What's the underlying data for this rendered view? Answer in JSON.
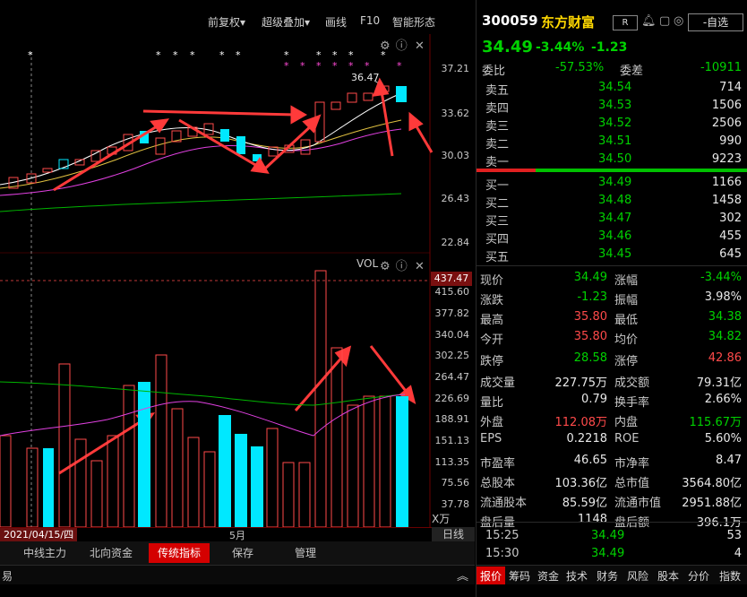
{
  "toolbar": {
    "items": [
      "前复权▾",
      "超级叠加▾",
      "画线",
      "F10",
      "智能形态"
    ]
  },
  "kline": {
    "yticks": [
      "37.21",
      "33.62",
      "30.03",
      "26.43",
      "22.84"
    ],
    "high_label": "36.47",
    "icons": [
      "gear-icon",
      "help-icon",
      "close-icon"
    ]
  },
  "vol": {
    "title": "VOL",
    "current": "437.47",
    "yticks": [
      "415.60",
      "377.82",
      "340.04",
      "302.25",
      "264.47",
      "226.69",
      "188.91",
      "151.13",
      "113.35",
      "75.56",
      "37.78"
    ],
    "unit": "X万"
  },
  "xaxis": {
    "date": "2021/04/15/四",
    "month": "5月",
    "period": "日线"
  },
  "tabs": [
    "中线主力",
    "北向资金",
    "传统指标",
    "保存",
    "管理"
  ],
  "tabs_active": 2,
  "bottom": {
    "left_text": "易",
    "right_tabs": [
      "报价",
      "筹码",
      "资金",
      "技术",
      "财务",
      "风险",
      "股本",
      "分价",
      "指数"
    ]
  },
  "quote": {
    "code": "300059",
    "name": "东方财富",
    "r_badge": "R",
    "watchlist": "-自选",
    "price": "34.49",
    "change_pct": "-3.44%",
    "change": "-1.23",
    "webi_label": "委比",
    "webi": "-57.53%",
    "wecha_label": "委差",
    "wecha": "-10911"
  },
  "asks": [
    {
      "label": "卖五",
      "price": "34.54",
      "vol": "714"
    },
    {
      "label": "卖四",
      "price": "34.53",
      "vol": "1506"
    },
    {
      "label": "卖三",
      "price": "34.52",
      "vol": "2506"
    },
    {
      "label": "卖二",
      "price": "34.51",
      "vol": "990"
    },
    {
      "label": "卖一",
      "price": "34.50",
      "vol": "9223"
    }
  ],
  "bids": [
    {
      "label": "买一",
      "price": "34.49",
      "vol": "1166"
    },
    {
      "label": "买二",
      "price": "34.48",
      "vol": "1458"
    },
    {
      "label": "买三",
      "price": "34.47",
      "vol": "302"
    },
    {
      "label": "买四",
      "price": "34.46",
      "vol": "455"
    },
    {
      "label": "买五",
      "price": "34.45",
      "vol": "645"
    }
  ],
  "stats": [
    [
      {
        "label": "现价",
        "value": "34.49",
        "color": "green"
      },
      {
        "label": "涨幅",
        "value": "-3.44%",
        "color": "green"
      }
    ],
    [
      {
        "label": "涨跌",
        "value": "-1.23",
        "color": "green"
      },
      {
        "label": "振幅",
        "value": "3.98%",
        "color": "white"
      }
    ],
    [
      {
        "label": "最高",
        "value": "35.80",
        "color": "red"
      },
      {
        "label": "最低",
        "value": "34.38",
        "color": "green"
      }
    ],
    [
      {
        "label": "今开",
        "value": "35.80",
        "color": "red"
      },
      {
        "label": "均价",
        "value": "34.82",
        "color": "green"
      }
    ],
    [
      {
        "label": "跌停",
        "value": "28.58",
        "color": "green"
      },
      {
        "label": "涨停",
        "value": "42.86",
        "color": "red"
      }
    ],
    [
      {
        "label": "成交量",
        "value": "227.75万",
        "color": "white"
      },
      {
        "label": "成交额",
        "value": "79.31亿",
        "color": "white"
      }
    ],
    [
      {
        "label": "量比",
        "value": "0.79",
        "color": "white"
      },
      {
        "label": "换手率",
        "value": "2.66%",
        "color": "white"
      }
    ],
    [
      {
        "label": "外盘",
        "value": "112.08万",
        "color": "red"
      },
      {
        "label": "内盘",
        "value": "115.67万",
        "color": "green"
      }
    ],
    [
      {
        "label": "EPS",
        "value": "0.2218",
        "color": "white"
      },
      {
        "label": "ROE",
        "value": "5.60%",
        "color": "white"
      }
    ],
    [
      {
        "label": "市盈率",
        "value": "46.65",
        "color": "white"
      },
      {
        "label": "市净率",
        "value": "8.47",
        "color": "white"
      }
    ],
    [
      {
        "label": "总股本",
        "value": "103.36亿",
        "color": "white"
      },
      {
        "label": "总市值",
        "value": "3564.80亿",
        "color": "white"
      }
    ],
    [
      {
        "label": "流通股本",
        "value": "85.59亿",
        "color": "white"
      },
      {
        "label": "流通市值",
        "value": "2951.88亿",
        "color": "white"
      }
    ],
    [
      {
        "label": "盘后量",
        "value": "1148",
        "color": "white"
      },
      {
        "label": "盘后额",
        "value": "396.1万",
        "color": "white"
      }
    ]
  ],
  "ticks": [
    {
      "time": "15:25",
      "price": "34.49",
      "vol": "53"
    },
    {
      "time": "15:30",
      "price": "34.49",
      "vol": "4"
    }
  ],
  "colors": {
    "up": "#ff4a4a",
    "down": "#00e8ff",
    "green": "#00d200",
    "bg": "#000000",
    "active_tab": "#d40000"
  }
}
